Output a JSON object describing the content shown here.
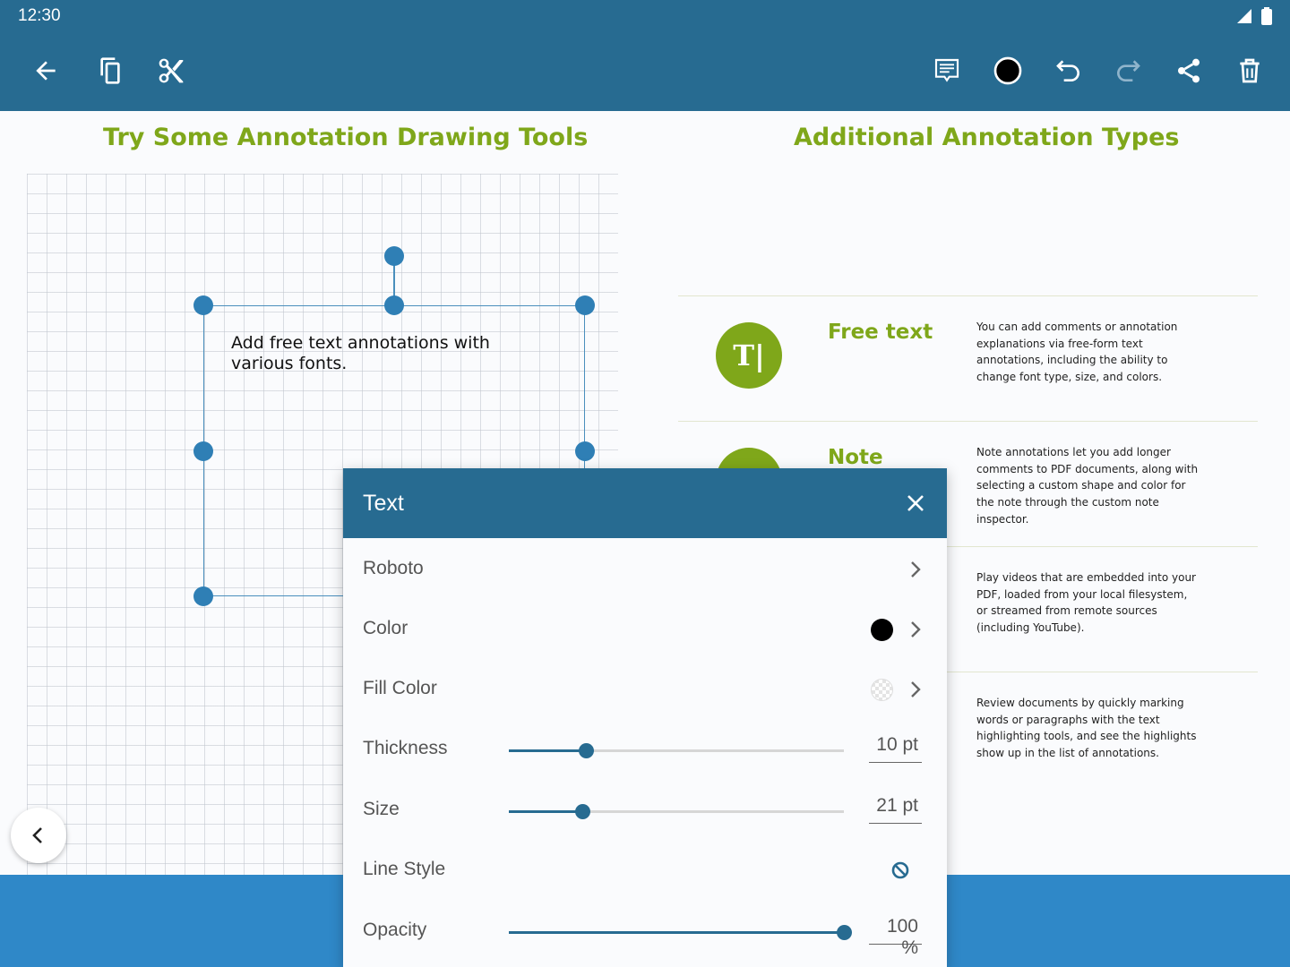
{
  "status_bar": {
    "time": "12:30"
  },
  "toolbar": {
    "left_icons": [
      "back-arrow-icon",
      "copy-icon",
      "scissors-icon"
    ],
    "right_icons": [
      "comment-icon",
      "color-circle-icon",
      "undo-icon",
      "redo-icon",
      "share-icon",
      "trash-icon"
    ],
    "active_color": "#000000"
  },
  "document": {
    "left_heading": "Try Some Annotation Drawing Tools",
    "right_heading": "Additional Annotation Types",
    "free_text_annotation": "Add free text annotations with various fonts.",
    "annotation_types": [
      {
        "title": "Free text",
        "icon_text": "T|",
        "description": "You can add comments or annotation explanations via free-form text annotations, including the ability to change font type, size, and colors."
      },
      {
        "title": "Note",
        "icon_text": "",
        "description": "Note annotations let you add longer comments to PDF documents, along with selecting a custom shape and color for the note through the custom note inspector."
      },
      {
        "title": "",
        "icon_text": "",
        "description": "Play videos that are embedded into your PDF, loaded from your local filesystem, or streamed from remote sources (including YouTube)."
      },
      {
        "title": "",
        "icon_text": "",
        "description": "Review documents by quickly marking words or paragraphs with the text highlighting tools, and see the highlights show up in the list of annotations."
      }
    ],
    "accent_color": "#7fa71a"
  },
  "inspector": {
    "title": "Text",
    "rows": {
      "font": {
        "label": "Roboto"
      },
      "color": {
        "label": "Color",
        "value": "#000000"
      },
      "fill_color": {
        "label": "Fill Color",
        "value": "transparent"
      },
      "thickness": {
        "label": "Thickness",
        "value": "10 pt",
        "level": 0.23
      },
      "size": {
        "label": "Size",
        "value": "21 pt",
        "level": 0.22
      },
      "line_style": {
        "label": "Line Style",
        "value_icon": "no-style-icon"
      },
      "opacity": {
        "label": "Opacity",
        "value": "100 %",
        "level": 1.0
      }
    }
  },
  "colors": {
    "app_bar": "#276b91",
    "bottom_bar": "#2f88c8",
    "handle": "#2f7fb5"
  }
}
